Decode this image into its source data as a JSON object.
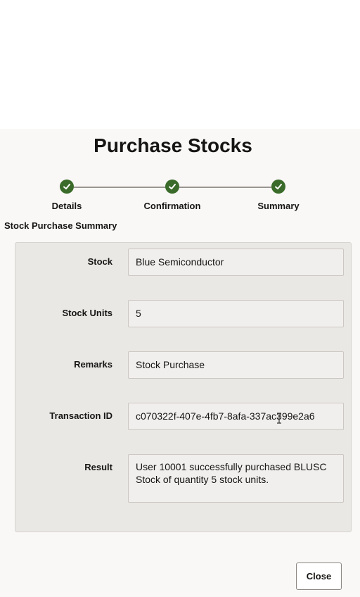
{
  "dialog": {
    "title": "Purchase Stocks",
    "section_title": "Stock Purchase Summary",
    "close_label": "Close"
  },
  "steps": [
    {
      "label": "Details",
      "status": "complete",
      "icon": "check-icon"
    },
    {
      "label": "Confirmation",
      "status": "complete",
      "icon": "check-icon"
    },
    {
      "label": "Summary",
      "status": "complete",
      "icon": "check-icon"
    }
  ],
  "summary": {
    "stock": {
      "label": "Stock",
      "value": "Blue Semiconductor"
    },
    "units": {
      "label": "Stock Units",
      "value": "5"
    },
    "remarks": {
      "label": "Remarks",
      "value": "Stock Purchase"
    },
    "transaction_id": {
      "label": "Transaction ID",
      "value": "c070322f-407e-4fb7-8afa-337ac399e2a6"
    },
    "result": {
      "label": "Result",
      "value": "User 10001 successfully purchased BLUSC Stock of quantity 5 stock units."
    }
  },
  "colors": {
    "step_complete": "#3b6b2a",
    "connector": "#9a9590",
    "panel_bg": "#eae8e5",
    "dialog_bg": "#f9f8f6"
  }
}
